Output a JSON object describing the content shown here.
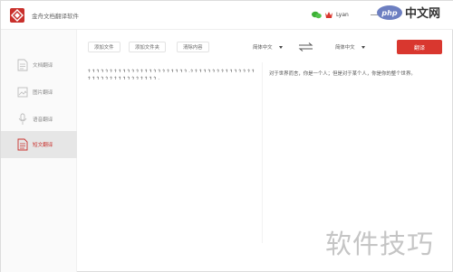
{
  "app": {
    "title": "金舟文档翻译软件"
  },
  "user": {
    "name": "Lyan"
  },
  "watermark": {
    "top": "php 中文网",
    "bottom": "软件技巧"
  },
  "sidebar": {
    "items": [
      {
        "label": "文档翻译",
        "icon": "document-icon",
        "active": false
      },
      {
        "label": "图片翻译",
        "icon": "image-icon",
        "active": false
      },
      {
        "label": "语音翻译",
        "icon": "voice-icon",
        "active": false
      },
      {
        "label": "短文翻译",
        "icon": "text-icon",
        "active": true
      }
    ]
  },
  "toolbar": {
    "add_file": "添加文件",
    "add_folder": "添加文件夹",
    "clear_content": "清除内容",
    "source_lang": "简体中文",
    "target_lang": "简体中文",
    "translate": "翻译"
  },
  "content": {
    "source": "ጎ ጎ ጎ ጎ ጎ  ጎ ጎ  ጎ ጎ ጎ ጎ  ጎ ጎ ጎ ጎ  ጎ  ጎ ጎ ጎ ጎ ጎ ጎ ጎ .ጎ  ጎ ጎ ጎ ጎ ጎ ጎ ጎ  ጎ  ጎ ጎ ጎ ጎ  ጎ ጎ ጎ ጎ  ጎ ጎ ጎ ጎ ጎ ጎ ጎ ጎ  ጎ ጎ ጎ ጎ ጎ ጎ .",
    "target": "对于世界而言，你是一个人；但是对于某个人，你是你的整个世界。"
  },
  "colors": {
    "accent": "#d9372f",
    "active_sidebar_bg": "#e6e6e6"
  }
}
